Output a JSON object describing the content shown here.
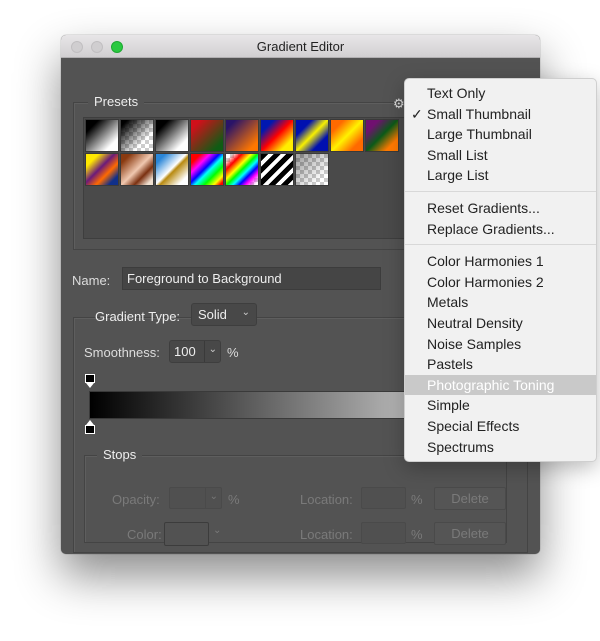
{
  "window": {
    "title": "Gradient Editor",
    "traffic_lights": [
      "close",
      "minimize",
      "zoom"
    ]
  },
  "presets": {
    "label": "Presets",
    "gear_icon": "⚙",
    "swatches": [
      {
        "name": "foreground-to-background",
        "css": "linear-gradient(135deg,#000 20%,#fff 80%)",
        "checker": false
      },
      {
        "name": "foreground-to-transparent",
        "css": "linear-gradient(135deg,#000 10%,rgba(0,0,0,0) 70%)",
        "checker": true
      },
      {
        "name": "black-white",
        "css": "linear-gradient(135deg,#000 20%,#fff 80%)",
        "checker": false
      },
      {
        "name": "red-green",
        "css": "linear-gradient(135deg,#d0101a 15%,#0f5c14 85%)",
        "checker": false
      },
      {
        "name": "violet-orange",
        "css": "linear-gradient(135deg,#2a1468 15%,#ff7700 85%)",
        "checker": false
      },
      {
        "name": "blue-red-yellow",
        "css": "linear-gradient(135deg,#0018b0 20%,#ff0000 50%,#ffee00 80%)",
        "checker": false
      },
      {
        "name": "blue-yellow-blue",
        "css": "linear-gradient(135deg,#0010b0 25%,#f8f000 50%,#0010b0 75%)",
        "checker": false
      },
      {
        "name": "orange-yellow-orange",
        "css": "linear-gradient(135deg,#ff6a00 20%,#fff200 50%,#ff6a00 80%)",
        "checker": false
      },
      {
        "name": "violet-green-orange",
        "css": "linear-gradient(135deg,#701070 20%,#0b5a18 50%,#ff7a00 80%)",
        "checker": false
      },
      {
        "name": "yellow-violet-orange-blue",
        "css": "linear-gradient(135deg,#ffe800 20%,#6a1a7a 45%,#ff6a00 65%,#10308a 85%)",
        "checker": false
      },
      {
        "name": "copper",
        "css": "linear-gradient(135deg,#8a3a10 15%,#f0c8b0 50%,#7a3010 70%,#f0e0d0 90%)",
        "checker": false
      },
      {
        "name": "chrome",
        "css": "linear-gradient(135deg,#2a86d8 15%,#ffffff 48%,#b88a10 55%,#ffffff 85%)",
        "checker": false
      },
      {
        "name": "spectrum",
        "css": "linear-gradient(135deg,#ff0000 15%,#ff00ff 30%,#0000ff 45%,#00ffff 55%,#00ff00 70%,#ffff00 85%,#ff0000 95%)",
        "checker": false
      },
      {
        "name": "transparent-rainbow",
        "css": "linear-gradient(135deg,rgba(255,0,0,0) 10%,#ff0000 25%,#ffff00 40%,#00ff00 50%,#00ffff 60%,#0000ff 70%,#ff00ff 80%,rgba(255,0,255,0) 95%)",
        "checker": true
      },
      {
        "name": "transparent-stripes",
        "css": "repeating-linear-gradient(135deg,#000 0,#000 5px,#fff 5px,#fff 9px)",
        "checker": false
      },
      {
        "name": "neutral-density",
        "css": "linear-gradient(135deg,rgba(0,0,0,0.35) 10%,rgba(0,0,0,0) 80%)",
        "checker": true
      }
    ]
  },
  "name_field": {
    "label": "Name:",
    "value": "Foreground to Background"
  },
  "gradient_type": {
    "label": "Gradient Type:",
    "selected": "Solid",
    "chevron": "⌄"
  },
  "smoothness": {
    "label": "Smoothness:",
    "value": "100",
    "unit": "%"
  },
  "stops": {
    "label": "Stops",
    "opacity_label": "Opacity:",
    "opacity_unit": "%",
    "color_label": "Color:",
    "location_label": "Location:",
    "location_unit": "%",
    "delete_label": "Delete"
  },
  "menu": {
    "checkmark": "✓",
    "groups": [
      [
        {
          "label": "Text Only",
          "checked": false
        },
        {
          "label": "Small Thumbnail",
          "checked": true
        },
        {
          "label": "Large Thumbnail",
          "checked": false
        },
        {
          "label": "Small List",
          "checked": false
        },
        {
          "label": "Large List",
          "checked": false
        }
      ],
      [
        {
          "label": "Reset Gradients...",
          "checked": false
        },
        {
          "label": "Replace Gradients...",
          "checked": false
        }
      ],
      [
        {
          "label": "Color Harmonies 1",
          "checked": false
        },
        {
          "label": "Color Harmonies 2",
          "checked": false
        },
        {
          "label": "Metals",
          "checked": false
        },
        {
          "label": "Neutral Density",
          "checked": false
        },
        {
          "label": "Noise Samples",
          "checked": false
        },
        {
          "label": "Pastels",
          "checked": false
        },
        {
          "label": "Photographic Toning",
          "checked": false,
          "highlighted": true
        },
        {
          "label": "Simple",
          "checked": false
        },
        {
          "label": "Special Effects",
          "checked": false
        },
        {
          "label": "Spectrums",
          "checked": false
        }
      ]
    ]
  }
}
